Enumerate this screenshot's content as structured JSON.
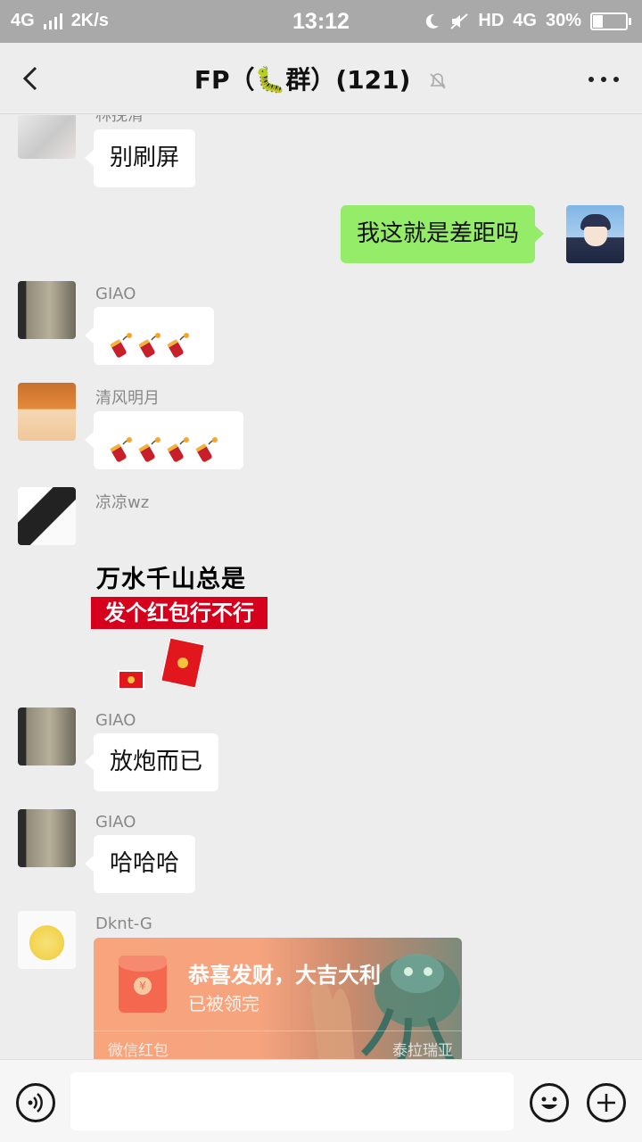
{
  "status_bar": {
    "network": "4G",
    "speed": "2K/s",
    "time": "13:12",
    "hd": "HD",
    "network_right": "4G",
    "battery": "30%",
    "battery_level": 0.3
  },
  "header": {
    "title": "FP（🐛群）(121)"
  },
  "messages": [
    {
      "sender": "林挽清",
      "text": "别刷屏",
      "side": "left"
    },
    {
      "sender": "",
      "text": "我这就是差距吗",
      "side": "right"
    },
    {
      "sender": "GIAO",
      "emoji_count": 3,
      "side": "left"
    },
    {
      "sender": "清风明月",
      "emoji_count": 4,
      "side": "left"
    },
    {
      "sender": "凉凉wz",
      "sticker_line1": "万水千山总是情",
      "sticker_line2": "发个红包行不行",
      "side": "left"
    },
    {
      "sender": "GIAO",
      "text": "放炮而已",
      "side": "left"
    },
    {
      "sender": "GIAO",
      "text": "哈哈哈",
      "side": "left"
    },
    {
      "sender": "Dknt-G",
      "packet_title": "恭喜发财，大吉大利",
      "packet_status": "已被领完",
      "packet_footer": "微信红包",
      "packet_skin": "泰拉瑞亚",
      "side": "left"
    }
  ],
  "input": {
    "placeholder": ""
  },
  "colors": {
    "self_bubble": "#95ec69",
    "background": "#ededed"
  }
}
